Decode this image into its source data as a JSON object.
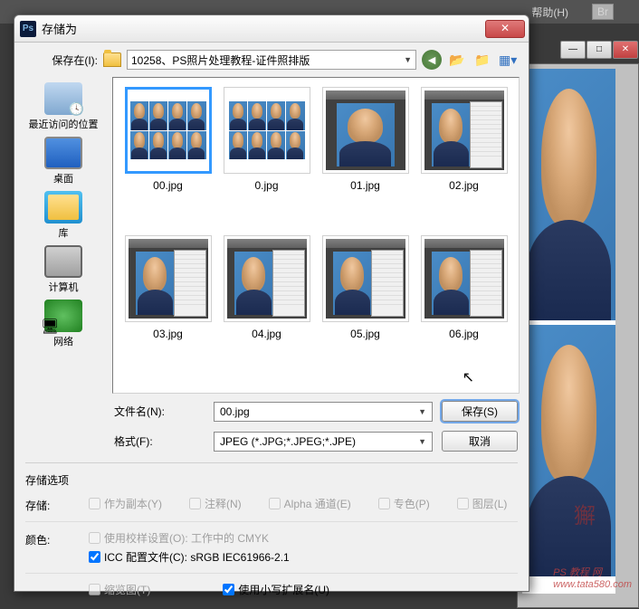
{
  "app_menu": {
    "help": "帮助(H)",
    "br_badge": "Br"
  },
  "dialog": {
    "title": "存储为",
    "location_label": "保存在(I):",
    "location_value": "10258、PS照片处理教程-证件照排版",
    "sidebar": [
      {
        "label": "最近访问的位置"
      },
      {
        "label": "桌面"
      },
      {
        "label": "库"
      },
      {
        "label": "计算机"
      },
      {
        "label": "网络"
      }
    ],
    "files": [
      {
        "name": "00.jpg",
        "kind": "grid8",
        "selected": true
      },
      {
        "name": "0.jpg",
        "kind": "grid8"
      },
      {
        "name": "01.jpg",
        "kind": "portrait"
      },
      {
        "name": "02.jpg",
        "kind": "ps-panel"
      },
      {
        "name": "03.jpg",
        "kind": "ps-panel"
      },
      {
        "name": "04.jpg",
        "kind": "ps-panel"
      },
      {
        "name": "05.jpg",
        "kind": "ps-panel"
      },
      {
        "name": "06.jpg",
        "kind": "ps-panel"
      }
    ],
    "filename_label": "文件名(N):",
    "filename_value": "00.jpg",
    "format_label": "格式(F):",
    "format_value": "JPEG (*.JPG;*.JPEG;*.JPE)",
    "save_btn": "保存(S)",
    "cancel_btn": "取消",
    "options": {
      "heading": "存储选项",
      "storage_label": "存储:",
      "as_copy": "作为副本(Y)",
      "alpha": "Alpha 通道(E)",
      "layers": "图层(L)",
      "notes": "注释(N)",
      "spot": "专色(P)",
      "color_label": "颜色:",
      "proof": "使用校样设置(O): 工作中的 CMYK",
      "icc": "ICC 配置文件(C): sRGB IEC61966-2.1",
      "thumb": "缩览图(T)",
      "lowercase": "使用小写扩展名(U)"
    }
  },
  "watermark": {
    "seal": "獬",
    "url": "www.tata580.com",
    "site": "PS 教程 网"
  }
}
